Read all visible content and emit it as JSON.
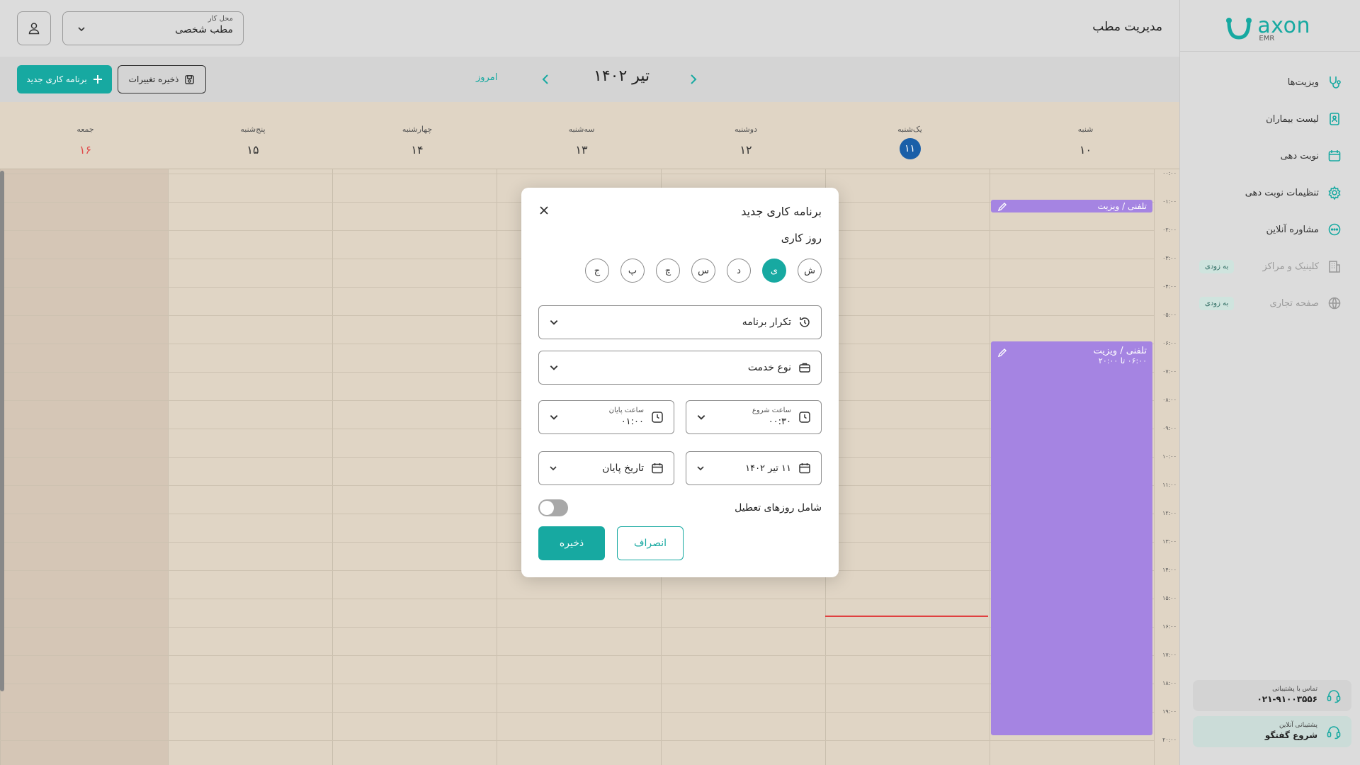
{
  "sidebar": {
    "logo": {
      "word": "axon",
      "sub": "EMR"
    },
    "items": [
      {
        "label": "ویزیت‌ها",
        "icon": "stethoscope-icon",
        "disabled": false
      },
      {
        "label": "لیست بیماران",
        "icon": "patient-list-icon",
        "disabled": false
      },
      {
        "label": "نوبت دهی",
        "icon": "calendar-icon",
        "disabled": false
      },
      {
        "label": "تنظیمات نوبت دهی",
        "icon": "gear-icon",
        "disabled": false
      },
      {
        "label": "مشاوره آنلاین",
        "icon": "chat-icon",
        "disabled": false
      },
      {
        "label": "کلینیک و مراکز",
        "icon": "building-icon",
        "disabled": true,
        "badge": "به زودی"
      },
      {
        "label": "صفحه تجاری",
        "icon": "globe-icon",
        "disabled": true,
        "badge": "به زودی"
      }
    ],
    "support_call": {
      "small": "تماس با پشتیبانی",
      "big": "۰۲۱-۹۱۰۰۳۵۵۶"
    },
    "support_chat": {
      "small": "پشتیبانی آنلاین",
      "big": "شروع گفتگو"
    }
  },
  "header": {
    "page_title": "مدیریت مطب",
    "workplace_label": "محل کار",
    "workplace_value": "مطب شخصی"
  },
  "toolbar": {
    "new_schedule": "برنامه کاری جدید",
    "save_changes": "ذخیره تغییرات",
    "today": "امروز",
    "month": "تیر ۱۴۰۲"
  },
  "days": [
    {
      "name": "شنبه",
      "num": "۱۰",
      "today": false,
      "friday": false
    },
    {
      "name": "یک‌شنبه",
      "num": "۱۱",
      "today": true,
      "friday": false
    },
    {
      "name": "دوشنبه",
      "num": "۱۲",
      "today": false,
      "friday": false
    },
    {
      "name": "سه‌شنبه",
      "num": "۱۳",
      "today": false,
      "friday": false
    },
    {
      "name": "چهارشنبه",
      "num": "۱۴",
      "today": false,
      "friday": false
    },
    {
      "name": "پنج‌شنبه",
      "num": "۱۵",
      "today": false,
      "friday": false
    },
    {
      "name": "جمعه",
      "num": "۱۶",
      "today": false,
      "friday": true
    }
  ],
  "hours": [
    "۰۰:۰۰",
    "۰۱:۰۰",
    "۰۲:۰۰",
    "۰۳:۰۰",
    "۰۴:۰۰",
    "۰۵:۰۰",
    "۰۶:۰۰",
    "۰۷:۰۰",
    "۰۸:۰۰",
    "۰۹:۰۰",
    "۱۰:۰۰",
    "۱۱:۰۰",
    "۱۲:۰۰",
    "۱۳:۰۰",
    "۱۴:۰۰",
    "۱۵:۰۰",
    "۱۶:۰۰",
    "۱۷:۰۰",
    "۱۸:۰۰",
    "۱۹:۰۰",
    "۲۰:۰۰"
  ],
  "events": {
    "small": {
      "title": "تلفنی / ویزیت"
    },
    "large": {
      "title": "تلفنی / ویزیت",
      "time": "۰۶:۰۰ تا ۲۰:۰۰"
    }
  },
  "modal": {
    "title": "برنامه کاری جدید",
    "workday_label": "روز کاری",
    "weekdays": [
      {
        "label": "ش",
        "active": false
      },
      {
        "label": "ی",
        "active": true
      },
      {
        "label": "د",
        "active": false
      },
      {
        "label": "س",
        "active": false
      },
      {
        "label": "چ",
        "active": false
      },
      {
        "label": "پ",
        "active": false
      },
      {
        "label": "ج",
        "active": false
      }
    ],
    "repeat": "تکرار برنامه",
    "service_type": "نوع خدمت",
    "start_time_label": "ساعت شروع",
    "start_time_value": "۰۰:۳۰",
    "end_time_label": "ساعت پایان",
    "end_time_value": "۰۱:۰۰",
    "start_date": "۱۱ تیر ۱۴۰۲",
    "end_date": "تاریخ پایان",
    "holidays_label": "شامل روزهای تعطیل",
    "holidays_enabled": false,
    "save": "ذخیره",
    "cancel": "انصراف"
  },
  "colors": {
    "brand": "#17a9a1",
    "event": "#a584e2",
    "today_circle": "#1a5fa8",
    "friday_text": "#e04b4b",
    "now_line": "#e04040"
  }
}
